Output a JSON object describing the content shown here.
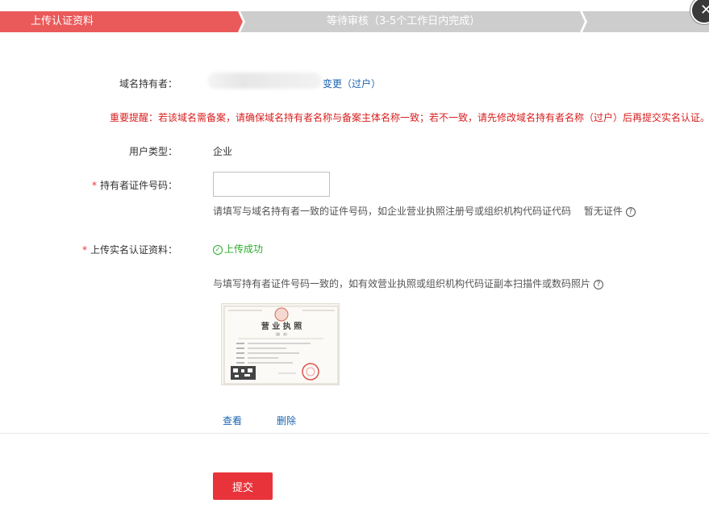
{
  "steps": [
    {
      "label": "上传认证资料",
      "active": true
    },
    {
      "label": "等待审核（3-5个工作日内完成）",
      "active": false
    }
  ],
  "colors": {
    "accent": "#e8333a",
    "step_active": "#ea5a5a",
    "step_inactive": "#cdcdcd",
    "link": "#1a64b0",
    "success": "#2bab2b",
    "warning": "#d81e1e"
  },
  "close_icon": "close-icon",
  "holder": {
    "label": "域名持有者：",
    "change_link": "变更（过户）"
  },
  "warning": "重要提醒：若该域名需备案，请确保域名持有者名称与备案主体名称一致；若不一致，请先修改域名持有者名称（过户）后再提交实名认证。",
  "user_type": {
    "label": "用户类型：",
    "value": "企业"
  },
  "id_number": {
    "required_mark": "*",
    "label": "持有者证件号码：",
    "value": "",
    "placeholder": "",
    "hint": "请填写与域名持有者一致的证件号码，如企业营业执照注册号或组织机构代码证代码",
    "no_id_link": "暂无证件"
  },
  "upload": {
    "required_mark": "*",
    "label": "上传实名认证资料：",
    "status": "上传成功",
    "hint": "与填写持有者证件号码一致的，如有效营业执照或组织机构代码证副本扫描件或数码照片",
    "thumbnail_title": "营 业 执 照",
    "thumbnail_sub": "（副　本）",
    "view_link": "查看",
    "delete_link": "删除"
  },
  "submit_label": "提交"
}
